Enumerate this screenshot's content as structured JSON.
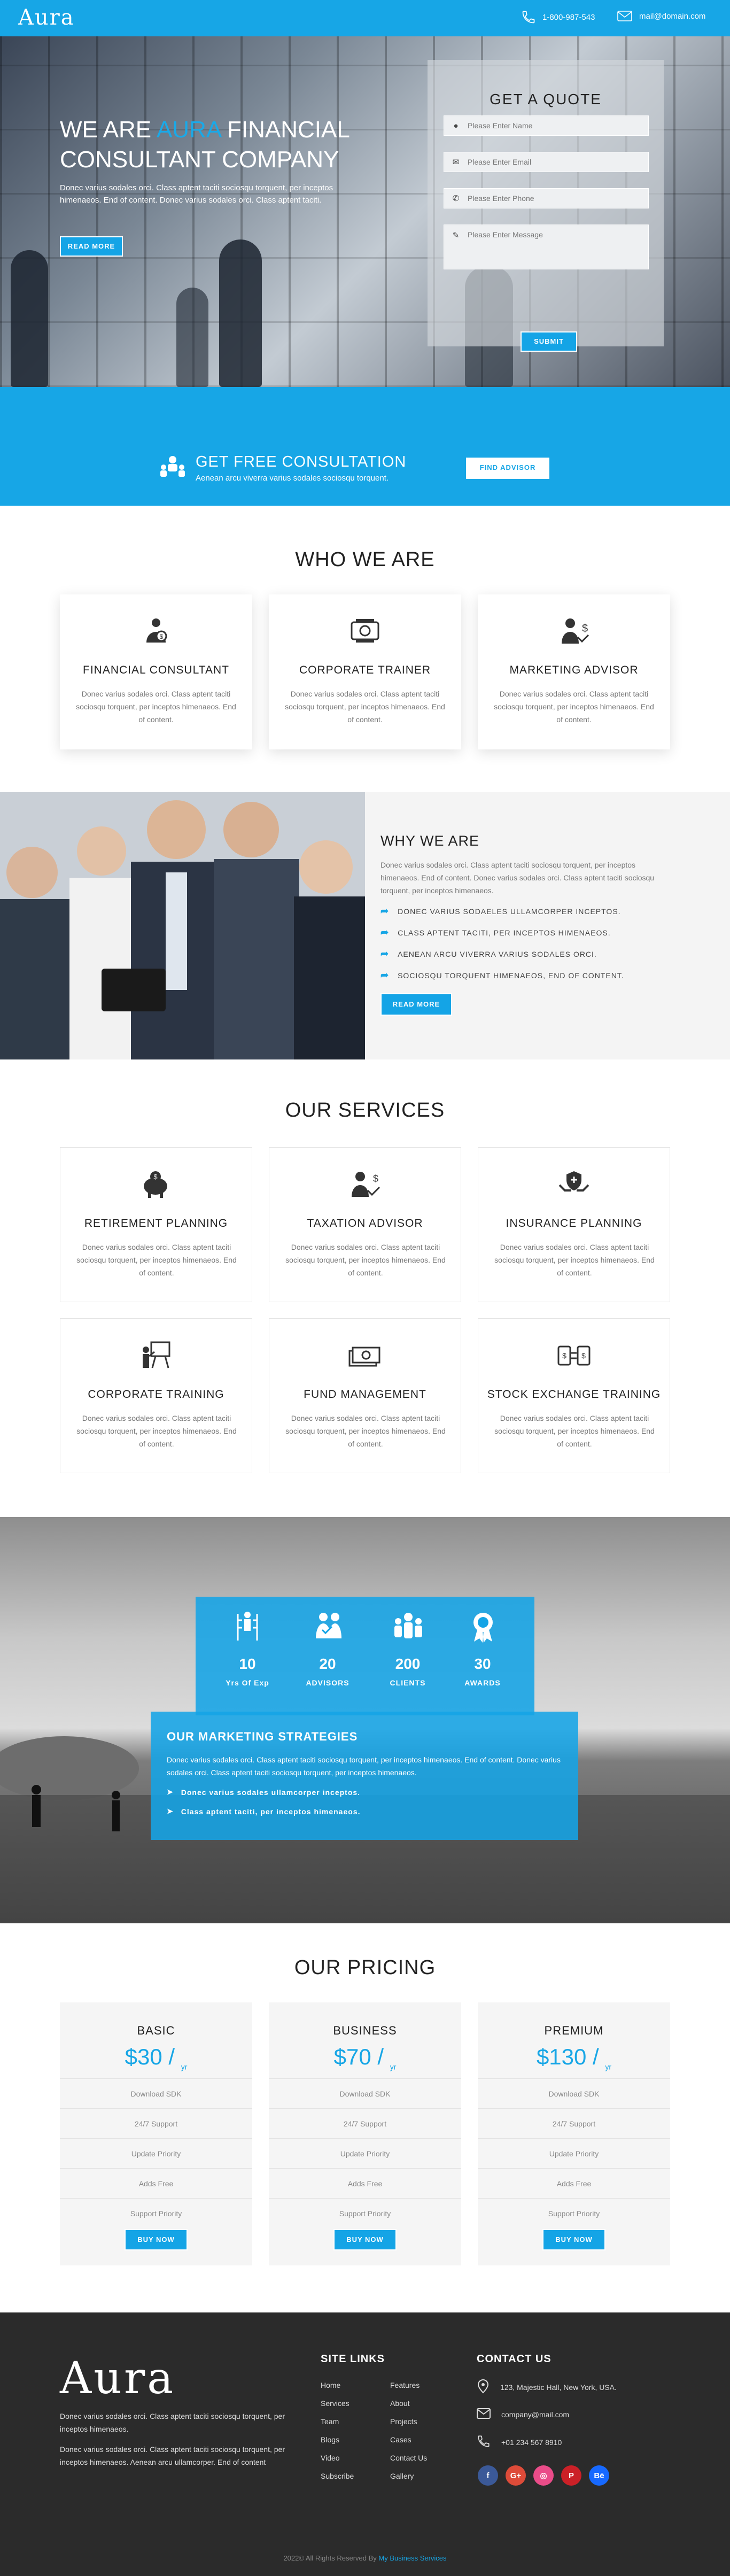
{
  "header": {
    "logo": "Aura",
    "phone": "1-800-987-543",
    "email": "mail@domain.com"
  },
  "hero": {
    "title_prefix": "WE ARE ",
    "title_highlight": "AURA",
    "title_suffix": " FINANCIAL CONSULTANT COMPANY",
    "text": "Donec varius sodales orci. Class aptent taciti sociosqu torquent, per inceptos himenaeos. End of content. Donec varius sodales orci. Class aptent taciti.",
    "button": "READ MORE"
  },
  "quote": {
    "title": "GET A QUOTE",
    "name_placeholder": "Please Enter Name",
    "email_placeholder": "Please Enter Email",
    "phone_placeholder": "Please Enter Phone",
    "message_placeholder": "Please Enter Message",
    "submit": "SUBMIT"
  },
  "consult": {
    "title": "GET FREE CONSULTATION",
    "subtitle": "Aenean arcu viverra varius sodales sociosqu torquent.",
    "button": "FIND ADVISOR"
  },
  "who": {
    "title": "WHO WE ARE",
    "cards": [
      {
        "title": "FINANCIAL CONSULTANT",
        "text": "Donec varius sodales orci. Class aptent taciti sociosqu torquent, per inceptos himenaeos. End of content.",
        "icon": "consultant-icon"
      },
      {
        "title": "CORPORATE TRAINER",
        "text": "Donec varius sodales orci. Class aptent taciti sociosqu torquent, per inceptos himenaeos. End of content.",
        "icon": "money-icon"
      },
      {
        "title": "MARKETING ADVISOR",
        "text": "Donec varius sodales orci. Class aptent taciti sociosqu torquent, per inceptos himenaeos. End of content.",
        "icon": "advisor-icon"
      }
    ]
  },
  "why": {
    "title": "WHY WE ARE",
    "text": "Donec varius sodales orci. Class aptent taciti sociosqu torquent, per inceptos himenaeos. End of content. Donec varius sodales orci. Class aptent taciti sociosqu torquent, per inceptos himenaeos.",
    "items": [
      "DONEC VARIUS SODAELES ULLAMCORPER INCEPTOS.",
      "CLASS APTENT TACITI, PER INCEPTOS HIMENAEOS.",
      "AENEAN ARCU VIVERRA VARIUS SODALES ORCI.",
      "SOCIOSQU TORQUENT HIMENAEOS, END OF CONTENT."
    ],
    "button": "READ MORE"
  },
  "services": {
    "title": "OUR SERVICES",
    "cards": [
      {
        "title": "RETIREMENT PLANNING",
        "text": "Donec varius sodales orci. Class aptent taciti sociosqu torquent, per inceptos himenaeos. End of content.",
        "icon": "piggy-bank-icon"
      },
      {
        "title": "TAXATION ADVISOR",
        "text": "Donec varius sodales orci. Class aptent taciti sociosqu torquent, per inceptos himenaeos. End of content.",
        "icon": "tax-advisor-icon"
      },
      {
        "title": "INSURANCE PLANNING",
        "text": "Donec varius sodales orci. Class aptent taciti sociosqu torquent, per inceptos himenaeos. End of content.",
        "icon": "insurance-hands-icon"
      },
      {
        "title": "CORPORATE TRAINING",
        "text": "Donec varius sodales orci. Class aptent taciti sociosqu torquent, per inceptos himenaeos. End of content.",
        "icon": "training-board-icon"
      },
      {
        "title": "FUND MANAGEMENT",
        "text": "Donec varius sodales orci. Class aptent taciti sociosqu torquent, per inceptos himenaeos. End of content.",
        "icon": "cash-stack-icon"
      },
      {
        "title": "STOCK EXCHANGE TRAINING",
        "text": "Donec varius sodales orci. Class aptent taciti sociosqu torquent, per inceptos himenaeos. End of content.",
        "icon": "exchange-icon"
      }
    ]
  },
  "stats": {
    "items": [
      {
        "num": "10",
        "label": "Yrs Of Exp",
        "icon": "ladder-icon"
      },
      {
        "num": "20",
        "label": "ADVISORS",
        "icon": "advisor-check-icon"
      },
      {
        "num": "200",
        "label": "CLIENTS",
        "icon": "clients-icon"
      },
      {
        "num": "30",
        "label": "AWARDS",
        "icon": "award-icon"
      }
    ]
  },
  "strategies": {
    "title": "OUR MARKETING STRATEGIES",
    "text": "Donec varius sodales orci. Class aptent taciti sociosqu torquent, per inceptos himenaeos. End of content. Donec varius sodales orci. Class aptent taciti sociosqu torquent, per inceptos himenaeos.",
    "items": [
      "Donec varius sodales ullamcorper inceptos.",
      "Class aptent taciti, per inceptos himenaeos."
    ]
  },
  "pricing": {
    "title": "OUR PRICING",
    "plans": [
      {
        "name": "BASIC",
        "price": "$30 / ",
        "unit": "yr"
      },
      {
        "name": "BUSINESS",
        "price": "$70 / ",
        "unit": "yr"
      },
      {
        "name": "PREMIUM",
        "price": "$130 / ",
        "unit": "yr"
      }
    ],
    "features": [
      "Download SDK",
      "24/7 Support",
      "Update Priority",
      "Adds Free",
      "Support Priority"
    ],
    "button": "BUY NOW"
  },
  "footer": {
    "logo": "Aura",
    "text1": "Donec varius sodales orci. Class aptent taciti sociosqu torquent, per inceptos himenaeos.",
    "text2": "Donec varius sodales orci. Class aptent taciti sociosqu torquent, per inceptos himenaeos. Aenean arcu ullamcorper. End of content",
    "links_title": "SITE LINKS",
    "links_col1": [
      "Home",
      "Services",
      "Team",
      "Blogs",
      "Video",
      "Subscribe"
    ],
    "links_col2": [
      "Features",
      "About",
      "Projects",
      "Cases",
      "Contact Us",
      "Gallery"
    ],
    "contact_title": "CONTACT US",
    "address": "123, Majestic Hall, New York, USA.",
    "email": "company@mail.com",
    "phone": "+01 234 567 8910",
    "social": [
      {
        "name": "facebook-icon",
        "glyph": "f",
        "color": "#3b5998"
      },
      {
        "name": "google-plus-icon",
        "glyph": "G+",
        "color": "#dd4b39"
      },
      {
        "name": "dribbble-icon",
        "glyph": "◎",
        "color": "#ea4c89"
      },
      {
        "name": "pinterest-icon",
        "glyph": "P",
        "color": "#cb2027"
      },
      {
        "name": "behance-icon",
        "glyph": "Bē",
        "color": "#1769ff"
      }
    ],
    "copyright_prefix": "2022© All Rights Reserved By ",
    "copyright_brand": "My Business Services"
  }
}
